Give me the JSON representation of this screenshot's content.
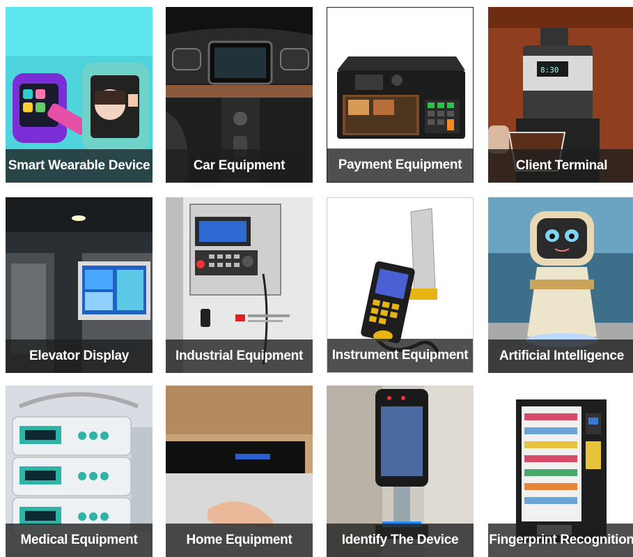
{
  "tiles": [
    {
      "label": "Smart Wearable Device",
      "icon": "smartwatch-image"
    },
    {
      "label": "Car Equipment",
      "icon": "car-dashboard-image"
    },
    {
      "label": "Payment Equipment",
      "icon": "payment-terminal-image"
    },
    {
      "label": "Client Terminal",
      "icon": "coffee-machine-image"
    },
    {
      "label": "Elevator Display",
      "icon": "elevator-display-image"
    },
    {
      "label": "Industrial Equipment",
      "icon": "industrial-control-panel-image"
    },
    {
      "label": "Instrument Equipment",
      "icon": "handheld-instrument-image"
    },
    {
      "label": "Artificial Intelligence",
      "icon": "robot-image"
    },
    {
      "label": "Medical Equipment",
      "icon": "infusion-pump-image"
    },
    {
      "label": "Home Equipment",
      "icon": "range-hood-image"
    },
    {
      "label": "Identify The Device",
      "icon": "face-recognition-terminal-image"
    },
    {
      "label": "Fingerprint Recognition",
      "icon": "vending-machine-image"
    }
  ]
}
